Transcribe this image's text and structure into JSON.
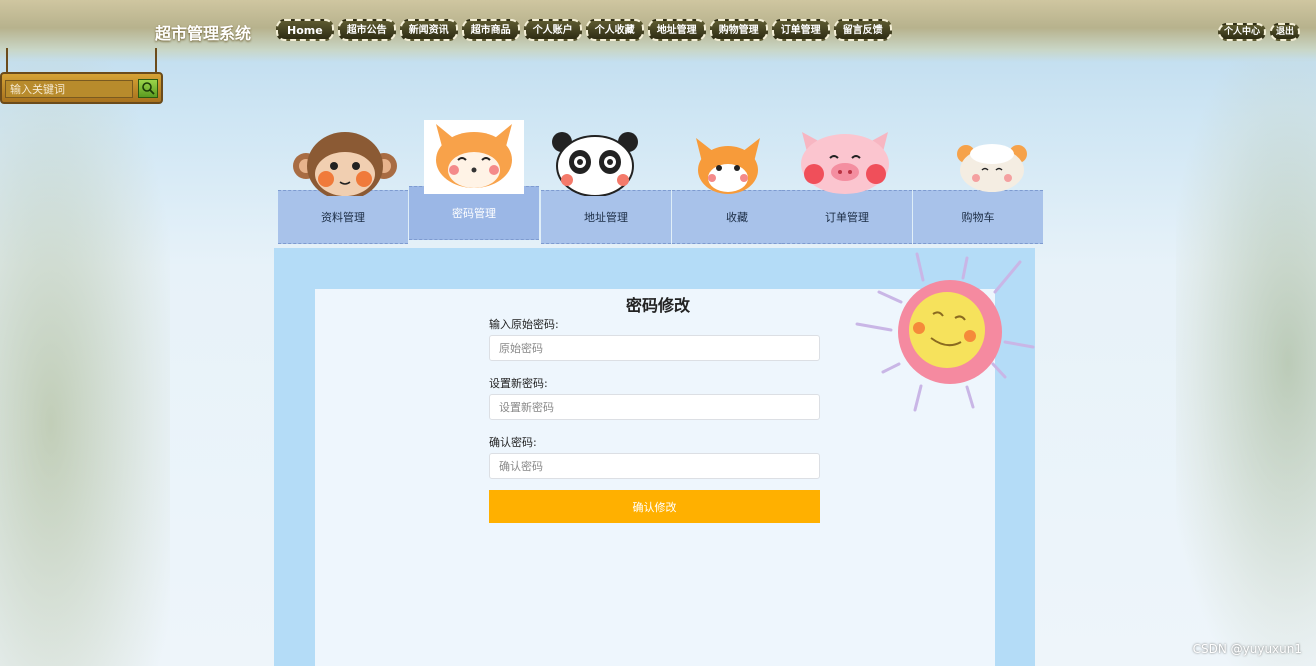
{
  "site_title": "超市管理系统",
  "nav": {
    "items": [
      {
        "label": "Home"
      },
      {
        "label": "超市公告"
      },
      {
        "label": "新闻资讯"
      },
      {
        "label": "超市商品"
      },
      {
        "label": "个人账户"
      },
      {
        "label": "个人收藏"
      },
      {
        "label": "地址管理"
      },
      {
        "label": "购物管理"
      },
      {
        "label": "订单管理"
      },
      {
        "label": "留言反馈"
      }
    ],
    "user_center": "个人中心",
    "logout": "退出"
  },
  "search": {
    "placeholder": "输入关键词"
  },
  "tabs": [
    {
      "label": "资料管理",
      "icon": "monkey-icon"
    },
    {
      "label": "密码管理",
      "icon": "fox-icon",
      "active": true
    },
    {
      "label": "地址管理",
      "icon": "panda-icon"
    },
    {
      "label": "收藏",
      "icon": "cat-icon"
    },
    {
      "label": "订单管理",
      "icon": "pig-icon"
    },
    {
      "label": "购物车",
      "icon": "sheep-icon"
    }
  ],
  "form": {
    "title": "密码修改",
    "old_password_label": "输入原始密码:",
    "old_password_placeholder": "原始密码",
    "new_password_label": "设置新密码:",
    "new_password_placeholder": "设置新密码",
    "confirm_password_label": "确认密码:",
    "confirm_password_placeholder": "确认密码",
    "submit_label": "确认修改"
  },
  "watermark": "CSDN @yuyuxun1",
  "colors": {
    "tab": "#a8c2ea",
    "frame": "#b4dcf7",
    "submit": "#ffb000"
  }
}
